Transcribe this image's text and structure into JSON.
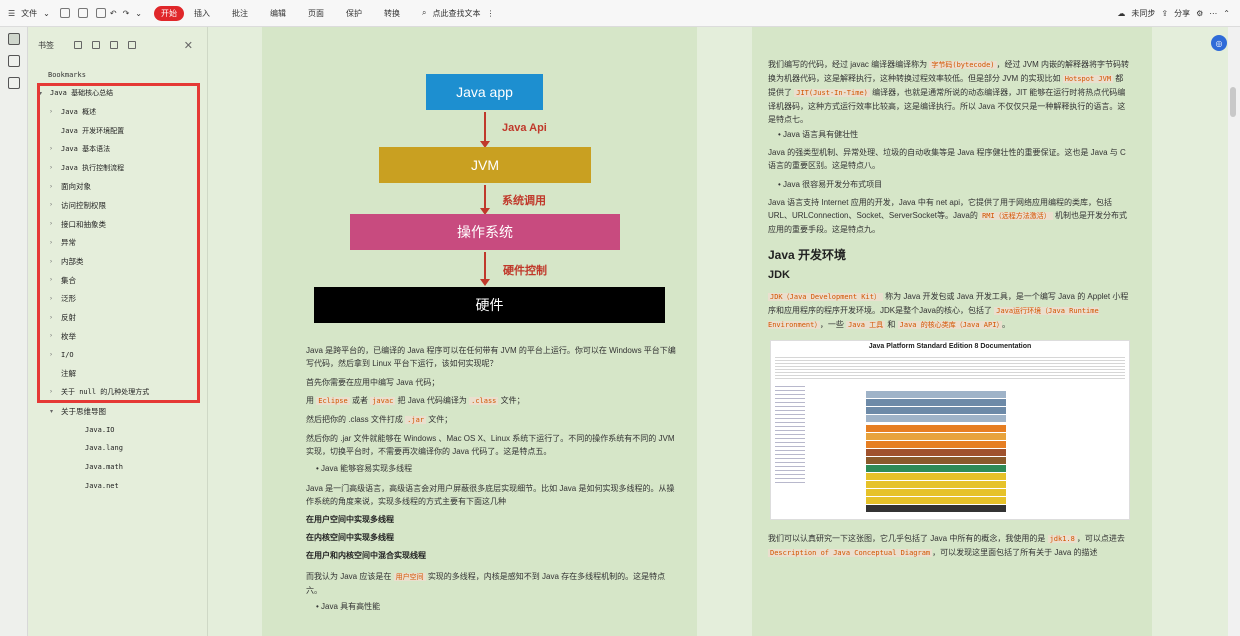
{
  "toolbar": {
    "file": "文件",
    "start": "开始",
    "insert": "插入",
    "annotate": "批注",
    "edit": "编辑",
    "page": "页面",
    "protect": "保护",
    "convert": "转换",
    "search": "点此查找文本",
    "sync": "未同步",
    "share": "分享"
  },
  "sidebar": {
    "title": "书签",
    "bookmarks_label": "Bookmarks",
    "items": [
      {
        "label": "Java 基础核心总结",
        "level": 0,
        "caret": "▾"
      },
      {
        "label": "Java 概述",
        "level": 1,
        "caret": "›"
      },
      {
        "label": "Java 开发环境配置",
        "level": 1,
        "caret": ""
      },
      {
        "label": "Java 基本语法",
        "level": 1,
        "caret": "›"
      },
      {
        "label": "Java 执行控制流程",
        "level": 1,
        "caret": "›"
      },
      {
        "label": "面向对象",
        "level": 1,
        "caret": "›"
      },
      {
        "label": "访问控制权限",
        "level": 1,
        "caret": "›"
      },
      {
        "label": "接口和抽象类",
        "level": 1,
        "caret": "›"
      },
      {
        "label": "异常",
        "level": 1,
        "caret": "›"
      },
      {
        "label": "内部类",
        "level": 1,
        "caret": "›"
      },
      {
        "label": "集合",
        "level": 1,
        "caret": "›"
      },
      {
        "label": "泛形",
        "level": 1,
        "caret": "›"
      },
      {
        "label": "反射",
        "level": 1,
        "caret": "›"
      },
      {
        "label": "枚举",
        "level": 1,
        "caret": "›"
      },
      {
        "label": "I/O",
        "level": 1,
        "caret": "›"
      },
      {
        "label": "注解",
        "level": 1,
        "caret": ""
      },
      {
        "label": "关于 null 的几种处理方式",
        "level": 1,
        "caret": "›"
      },
      {
        "label": "关于思维导图",
        "level": 1,
        "caret": "▾"
      },
      {
        "label": "Java.IO",
        "level": 2,
        "caret": ""
      },
      {
        "label": "Java.lang",
        "level": 2,
        "caret": ""
      },
      {
        "label": "Java.math",
        "level": 2,
        "caret": ""
      },
      {
        "label": "Java.net",
        "level": 2,
        "caret": ""
      }
    ]
  },
  "diagram": {
    "app": "Java app",
    "api": "Java Api",
    "jvm": "JVM",
    "syscall": "系统调用",
    "os": "操作系统",
    "hwctl": "硬件控制",
    "hw": "硬件"
  },
  "page1": {
    "p1": "Java 是跨平台的，已编译的 Java 程序可以在任何带有 JVM 的平台上运行。你可以在 Windows 平台下编写代码，然后拿到 Linux 平台下运行，该如何实现呢？",
    "p2": "首先你需要在应用中编写 Java 代码；",
    "p3a": "用",
    "p3b": "Eclipse",
    "p3c": "或者",
    "p3d": "javac",
    "p3e": "把 Java 代码编译为",
    "p3f": ".class",
    "p3g": "文件；",
    "p4a": "然后把你的 .class 文件打成",
    "p4b": ".jar",
    "p4c": "文件；",
    "p5": "然后你的 .jar 文件就能够在 Windows 、Mac OS X、Linux 系统下运行了。不同的操作系统有不同的 JVM 实现，切换平台时，不需要再次编译你的 Java 代码了。这是特点五。",
    "b1": "Java 能够容易实现多线程",
    "p6": "Java 是一门高级语言，高级语言会对用户屏蔽很多底层实现细节。比如 Java 是如何实现多线程的。从操作系统的角度来说，实现多线程的方式主要有下面这几种",
    "h1": "在用户空间中实现多线程",
    "h2": "在内核空间中实现多线程",
    "h3": "在用户和内核空间中混合实现线程",
    "p7a": "而我认为 Java 应该是在",
    "p7b": "用户空间",
    "p7c": "实现的多线程，内核是感知不到 Java 存在多线程机制的。这是特点六。",
    "b2": "Java 具有高性能"
  },
  "page2": {
    "p1a": "我们编写的代码，经过 javac 编译器编译称为",
    "p1b": "字节码(bytecode)",
    "p1c": "，经过 JVM 内嵌的解释器将字节码转换为机器代码，这是解释执行，这种转换过程效率较低。但是部分 JVM 的实现比如",
    "p1d": "Hotspot JVM",
    "p1e": "都提供了",
    "p1f": "JIT(Just-In-Time)",
    "p1g": "编译器，也就是通常所说的动态编译器，JIT 能够在运行时将热点代码编译机器码，这种方式运行效率比较高，这是编译执行。所以 Java 不仅仅只是一种解释执行的语言。这是特点七。",
    "b1": "Java 语言具有健壮性",
    "p2": "Java 的强类型机制、异常处理、垃圾的自动收集等是 Java 程序健壮性的重要保证。这也是 Java 与 C 语言的重要区别。这是特点八。",
    "b2": "Java 很容易开发分布式项目",
    "p3a": "Java 语言支持 Internet 应用的开发，Java 中有 net api，它提供了用于网络应用编程的类库，包括 URL、URLConnection、Socket、ServerSocket等。Java的",
    "p3b": "RMI（远程方法激活）",
    "p3c": "机制也是开发分布式应用的重要手段。这是特点九。",
    "h_env": "Java 开发环境",
    "h_jdk": "JDK",
    "p4a": "JDK（Java Development Kit）",
    "p4b": "称为 Java 开发包或 Java 开发工具，是一个编写 Java 的 Applet 小程序和应用程序的程序开发环境。JDK是整个Java的核心，包括了",
    "p4c": "Java运行环境（Java Runtime Environment）",
    "p4d": "，一些",
    "p4e": "Java 工具",
    "p4f": "和",
    "p4g": "Java 的核心类库（Java API）",
    "p4h": "。",
    "img_title": "Java Platform Standard Edition 8 Documentation",
    "p5a": "我们可以认真研究一下这张图，它几乎包括了 Java 中所有的概念，我使用的是",
    "p5b": "jdk1.8",
    "p5c": "，可以点进去",
    "p5d": "Description of Java Conceptual Diagram",
    "p5e": "，可以发现这里面包括了所有关于 Java 的描述"
  },
  "colors": {
    "app": "#1d8fd0",
    "jvm": "#c9a021",
    "os": "#c84b7f",
    "hw": "#000000",
    "accent": "#e0272a"
  }
}
